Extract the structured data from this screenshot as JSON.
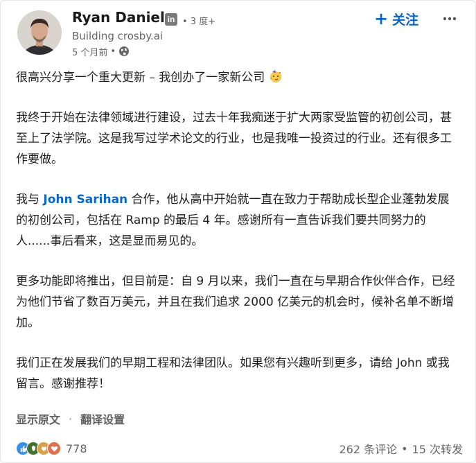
{
  "author": {
    "name": "Ryan Daniels",
    "badge": "in",
    "degree": "• 3 度+",
    "headline": "Building crosby.ai",
    "time": "5 个月前",
    "meta_dot": "•",
    "visibility_icon": "globe-icon"
  },
  "actions": {
    "follow_plus": "+",
    "follow_label": "关注",
    "more_icon": "ellipsis-icon"
  },
  "post": {
    "p1": "很高兴分享一个重大更新 – 我创办了一家新公司",
    "p1_emoji": "party-face-emoji",
    "p2": "我终于开始在法律领域进行建设，过去十年我痴迷于扩大两家受监管的初创公司，甚至上了法学院。这是我写过学术论文的行业，也是我唯一投资过的行业。还有很多工作要做。",
    "p3_before": "我与 ",
    "p3_mention": "John Sarihan",
    "p3_after": " 合作，他从高中开始就一直在致力于帮助成长型企业蓬勃发展的初创公司，包括在 Ramp 的最后 4 年。感谢所有一直告诉我们要共同努力的人......事后看来，这是显而易见的。",
    "p4": "更多功能即将推出，但目前是：自 9 月以来，我们一直在与早期合作伙伴合作，已经为他们节省了数百万美元，并且在我们追求 2000 亿美元的机会时，候补名单不断增加。",
    "p5": "我们正在发展我们的早期工程和法律团队。如果您有兴趣听到更多，请给 John 或我留言。感谢推荐！"
  },
  "translation": {
    "show_original": "显示原文",
    "separator": "·",
    "settings": "翻译设置"
  },
  "social": {
    "reactions_count": "778",
    "reaction_icons": [
      "like-icon",
      "celebrate-icon",
      "support-icon",
      "love-icon"
    ],
    "comments": "262 条评论",
    "bullet": "•",
    "reposts": "15 次转发"
  },
  "colors": {
    "link_blue": "#0a66c2",
    "muted": "#666666",
    "like": "#378fe9",
    "celebrate": "#44712e",
    "support": "#d8a24d",
    "love": "#df704d"
  }
}
